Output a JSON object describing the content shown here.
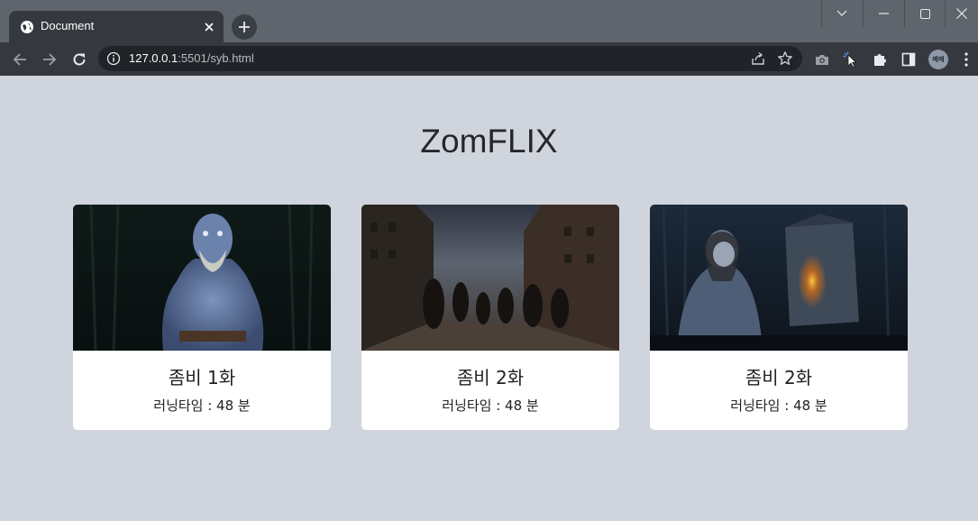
{
  "browser": {
    "tab": {
      "title": "Document",
      "favicon": "globe-icon"
    },
    "new_tab_icon": "plus-icon",
    "window_controls": [
      "chevron-down-icon",
      "minimize-icon",
      "maximize-icon",
      "close-icon"
    ],
    "address_bar": {
      "host": "127.0.0.1",
      "path": ":5501/syb.html"
    },
    "profile_initials": "메메"
  },
  "page": {
    "title": "ZomFLIX",
    "cards": [
      {
        "title": "좀비 1화",
        "meta": "러닝타임 : 48 분",
        "image": "zombie-creature-forest"
      },
      {
        "title": "좀비 2화",
        "meta": "러닝타임 : 48 분",
        "image": "zombie-horde-city-street"
      },
      {
        "title": "좀비 2화",
        "meta": "러닝타임 : 48 분",
        "image": "girl-dark-forest-outhouse"
      }
    ]
  }
}
